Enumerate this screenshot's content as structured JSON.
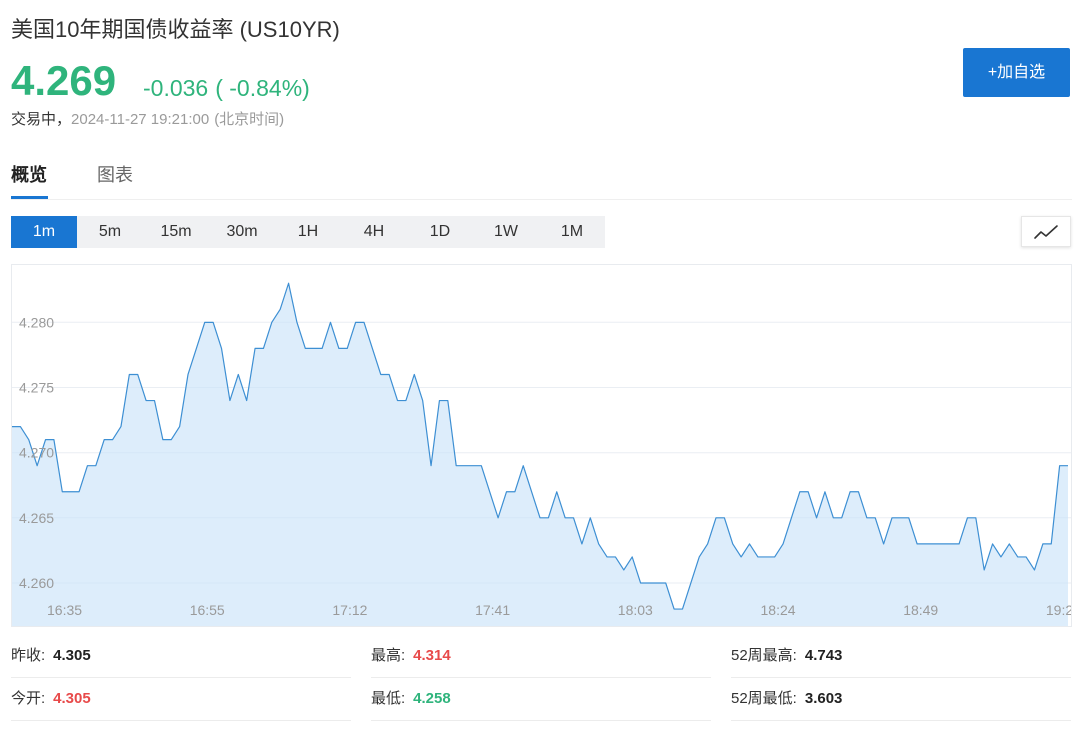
{
  "header": {
    "title": "美国10年期国债收益率 (US10YR)"
  },
  "quote": {
    "price": "4.269",
    "change": "-0.036",
    "change_pct": "( -0.84%)",
    "status": "交易中，",
    "timestamp": "2024-11-27 19:21:00",
    "timezone": "(北京时间)",
    "color": "#2fb47c"
  },
  "actions": {
    "watchlist_button": "+加自选"
  },
  "tabs": {
    "items": [
      "概览",
      "图表"
    ],
    "active": 0
  },
  "ranges": {
    "items": [
      "1m",
      "5m",
      "15m",
      "30m",
      "1H",
      "4H",
      "1D",
      "1W",
      "1M"
    ],
    "active": "1m"
  },
  "toolbar": {
    "chart_type_icon": "line-chart-icon"
  },
  "colors": {
    "accent": "#1976d2",
    "up": "#e84a4a",
    "down": "#2fb47c",
    "neutral": "#222222",
    "line": "#3d8fd3",
    "fill": "#c8e2f8",
    "grid": "#eaeef3",
    "axis_text": "#9a9a9a"
  },
  "chart_data": {
    "type": "area",
    "title": "",
    "xlabel": "",
    "ylabel": "",
    "ylim": [
      4.2567,
      4.2844
    ],
    "yticks": [
      "4.280",
      "4.275",
      "4.270",
      "4.265",
      "4.260"
    ],
    "xticks": [
      "16:35",
      "16:55",
      "17:12",
      "17:41",
      "18:03",
      "18:24",
      "18:49",
      "19:2"
    ],
    "grid": true,
    "legend": "none",
    "series": [
      {
        "values": [
          4.272,
          4.272,
          4.271,
          4.269,
          4.271,
          4.271,
          4.267,
          4.267,
          4.267,
          4.269,
          4.269,
          4.271,
          4.271,
          4.272,
          4.276,
          4.276,
          4.274,
          4.274,
          4.271,
          4.271,
          4.272,
          4.276,
          4.278,
          4.28,
          4.28,
          4.278,
          4.274,
          4.276,
          4.274,
          4.278,
          4.278,
          4.28,
          4.281,
          4.283,
          4.28,
          4.278,
          4.278,
          4.278,
          4.28,
          4.278,
          4.278,
          4.28,
          4.28,
          4.278,
          4.276,
          4.276,
          4.274,
          4.274,
          4.276,
          4.274,
          4.269,
          4.274,
          4.274,
          4.269,
          4.269,
          4.269,
          4.269,
          4.267,
          4.265,
          4.267,
          4.267,
          4.269,
          4.267,
          4.265,
          4.265,
          4.267,
          4.265,
          4.265,
          4.263,
          4.265,
          4.263,
          4.262,
          4.262,
          4.261,
          4.262,
          4.26,
          4.26,
          4.26,
          4.26,
          4.258,
          4.258,
          4.26,
          4.262,
          4.263,
          4.265,
          4.265,
          4.263,
          4.262,
          4.263,
          4.262,
          4.262,
          4.262,
          4.263,
          4.265,
          4.267,
          4.267,
          4.265,
          4.267,
          4.265,
          4.265,
          4.267,
          4.267,
          4.265,
          4.265,
          4.263,
          4.265,
          4.265,
          4.265,
          4.263,
          4.263,
          4.263,
          4.263,
          4.263,
          4.263,
          4.265,
          4.265,
          4.261,
          4.263,
          4.262,
          4.263,
          4.262,
          4.262,
          4.261,
          4.263,
          4.263,
          4.269,
          4.269
        ]
      }
    ]
  },
  "stats": {
    "prev_close": {
      "label": "昨收:",
      "value": "4.305",
      "color": "#222222"
    },
    "open": {
      "label": "今开:",
      "value": "4.305",
      "color": "#e84a4a"
    },
    "high": {
      "label": "最高:",
      "value": "4.314",
      "color": "#e84a4a"
    },
    "low": {
      "label": "最低:",
      "value": "4.258",
      "color": "#2fb47c"
    },
    "week52_high": {
      "label": "52周最高:",
      "value": "4.743",
      "color": "#222222"
    },
    "week52_low": {
      "label": "52周最低:",
      "value": "3.603",
      "color": "#222222"
    }
  }
}
